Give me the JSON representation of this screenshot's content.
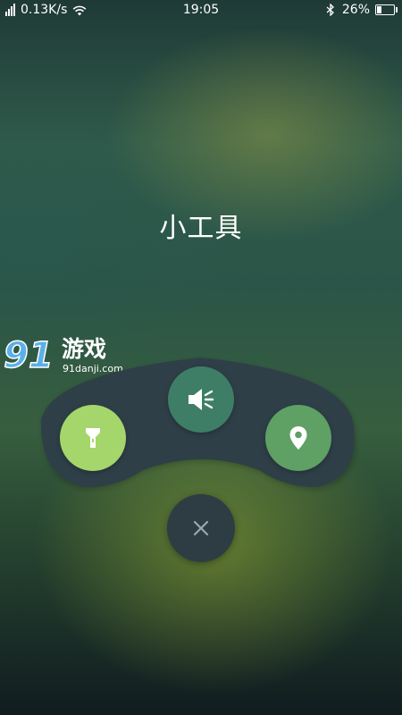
{
  "status_bar": {
    "network_speed": "0.13K/s",
    "time": "19:05",
    "battery_percent": "26%",
    "battery_level": 0.26,
    "icons": [
      "signal-icon",
      "wifi-icon",
      "bluetooth-icon",
      "battery-icon"
    ]
  },
  "page": {
    "title": "小工具"
  },
  "watermark": {
    "digits": "91",
    "name": "游戏",
    "url": "91danji.com"
  },
  "tools": [
    {
      "name": "flashlight",
      "icon": "flashlight-icon",
      "color": "#a4d66c"
    },
    {
      "name": "sound",
      "icon": "speaker-icon",
      "color": "#3f7e66"
    },
    {
      "name": "location",
      "icon": "location-pin-icon",
      "color": "#5fa065"
    }
  ],
  "close": {
    "icon": "close-icon",
    "color": "#2e3d44"
  },
  "colors": {
    "panel": "#2f3f48",
    "icon_white": "#ffffff",
    "close_glyph": "#9aa7ad"
  }
}
